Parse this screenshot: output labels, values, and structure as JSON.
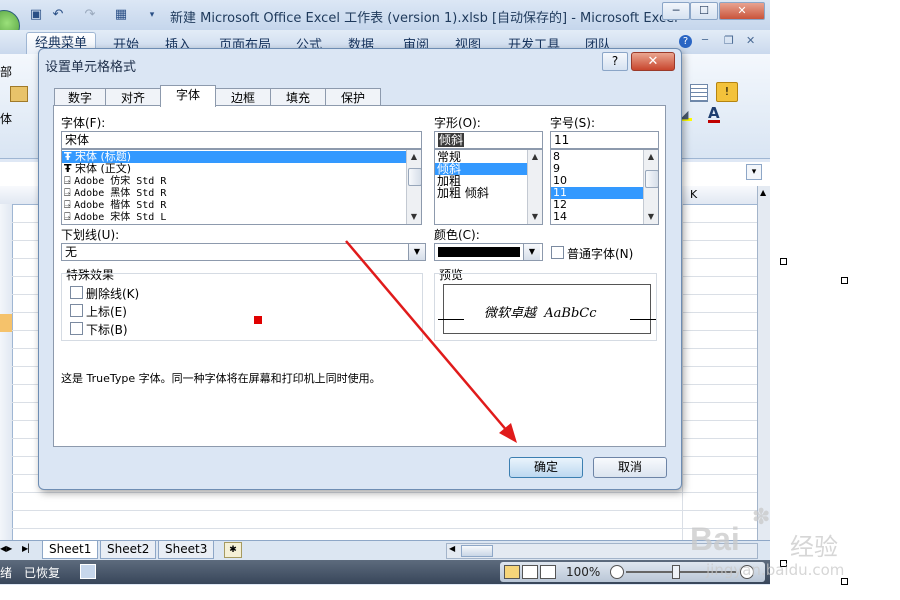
{
  "window": {
    "title": "新建 Microsoft Office Excel 工作表 (version 1).xlsb [自动保存的] - Microsoft Excel",
    "min": "─",
    "max": "☐",
    "close": "✕"
  },
  "menu": {
    "tabs": [
      "经典菜单",
      "开始",
      "插入",
      "页面布局",
      "公式",
      "数据",
      "审阅",
      "视图",
      "开发工具",
      "团队"
    ],
    "left_partial": "部",
    "left_partial2": "体"
  },
  "sheet": {
    "column_partial": "K",
    "tabs": [
      "Sheet1",
      "Sheet2",
      "Sheet3"
    ]
  },
  "status": {
    "left_partial": "绪",
    "recovered": "已恢复",
    "zoom": "100%"
  },
  "dialog": {
    "title": "设置单元格格式",
    "help": "?",
    "close": "✕",
    "tabs": [
      "数字",
      "对齐",
      "字体",
      "边框",
      "填充",
      "保护"
    ],
    "font": {
      "label": "字体(F):",
      "value": "宋体",
      "items": [
        "宋体 (标题)",
        "宋体 (正文)",
        "Adobe 仿宋 Std R",
        "Adobe 黑体 Std R",
        "Adobe 楷体 Std R",
        "Adobe 宋体 Std L"
      ],
      "item_icons": [
        "Ŧ",
        "Ŧ",
        "⍈",
        "⍈",
        "⍈",
        "⍈"
      ]
    },
    "style": {
      "label": "字形(O):",
      "value": "倾斜",
      "items": [
        "常规",
        "倾斜",
        "加粗",
        "加粗 倾斜"
      ]
    },
    "size": {
      "label": "字号(S):",
      "value": "11",
      "items": [
        "8",
        "9",
        "10",
        "11",
        "12",
        "14"
      ]
    },
    "underline": {
      "label": "下划线(U):",
      "value": "无"
    },
    "color": {
      "label": "颜色(C):",
      "normal_font": "普通字体(N)"
    },
    "effects": {
      "label": "特殊效果",
      "strike": "删除线(K)",
      "superscript": "上标(E)",
      "subscript": "下标(B)"
    },
    "preview": {
      "label": "预览",
      "sample": "微软卓越  AaBbCc"
    },
    "note": "这是 TrueType 字体。同一种字体将在屏幕和打印机上同时使用。",
    "ok": "确定",
    "cancel": "取消"
  },
  "watermark": {
    "brand": "Bai",
    "brand_cn": "经验",
    "url": "jingyan.baidu.com"
  },
  "colors": {
    "accent": "#3399ff",
    "arrow": "#e01b1b",
    "marker": "#e00000"
  }
}
